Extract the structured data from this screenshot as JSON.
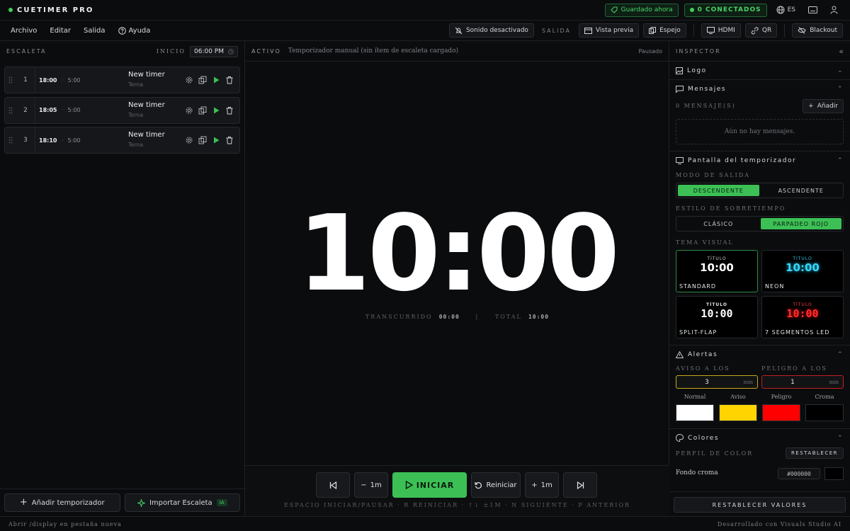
{
  "app": {
    "brand": "CUETIMER PRO"
  },
  "top": {
    "saved": "Guardado ahora",
    "connected": "0 CONECTADOS",
    "lang": "ES"
  },
  "menu": {
    "archivo": "Archivo",
    "editar": "Editar",
    "salida": "Salida",
    "ayuda": "Ayuda"
  },
  "toolbar": {
    "sound": "Sonido desactivado",
    "salida_label": "SALIDA",
    "preview": "Vista previa",
    "mirror": "Espejo",
    "hdmi": "HDMI",
    "qr": "QR",
    "blackout": "Blackout"
  },
  "left": {
    "title": "ESCALETA",
    "inicio_label": "INICIO",
    "start_time": "06:00 PM",
    "rows": [
      {
        "num": "1",
        "time": "18:00",
        "dot": "·",
        "dur": "5:00",
        "name": "New timer",
        "tema": "Tema"
      },
      {
        "num": "2",
        "time": "18:05",
        "dot": "·",
        "dur": "5:00",
        "name": "New timer",
        "tema": "Tema"
      },
      {
        "num": "3",
        "time": "18:10",
        "dot": "·",
        "dur": "5:00",
        "name": "New timer",
        "tema": "Tema"
      }
    ],
    "add": "Añadir temporizador",
    "import": "Importar Escaleta",
    "ia": "IA"
  },
  "center": {
    "active": "ACTIVO",
    "desc": "Temporizador manual (sin ítem de escaleta cargado)",
    "state": "Pausado",
    "time": "10:00",
    "elapsed_label": "TRANSCURRIDO",
    "elapsed": "00:00",
    "divider": "|",
    "total_label": "TOTAL",
    "total": "10:00",
    "minus": "1m",
    "play": "INICIAR",
    "reset": "Reiniciar",
    "plus": "1m",
    "shortcuts": "ESPACIO INICIAR/PAUSAR · R REINICIAR · ↑↓ ±1M · N SIGUIENTE · P ANTERIOR"
  },
  "inspector": {
    "title": "INSPECTOR",
    "logo": "Logo",
    "mensajes": "Mensajes",
    "msg_count": "0 MENSAJE(S)",
    "add": "Añadir",
    "empty": "Aún no hay mensajes.",
    "pantalla": "Pantalla del temporizador",
    "modo_label": "MODO DE SALIDA",
    "desc": "DESCENDENTE",
    "asc": "ASCENDENTE",
    "over_label": "ESTILO DE SOBRETIEMPO",
    "clasico": "CLÁSICO",
    "parpadeo": "PARPADEO ROJO",
    "tema_label": "TEMA VISUAL",
    "themes": [
      {
        "title": "TÍTULO",
        "value": "10:00",
        "name": "STANDARD"
      },
      {
        "title": "TÍTULO",
        "value": "10:00",
        "name": "NEON"
      },
      {
        "title": "TÍTULO",
        "value": "10:00",
        "name": "SPLIT-FLAP"
      },
      {
        "title": "TÍTULO",
        "value": "10:00",
        "name": "7 SEGMENTOS LED"
      }
    ],
    "alertas": "Alertas",
    "aviso_label": "AVISO A LOS",
    "aviso": "3",
    "peligro_label": "PELIGRO A LOS",
    "peligro": "1",
    "unit": "min",
    "swatches": [
      {
        "name": "Normal",
        "color": "#ffffff"
      },
      {
        "name": "Aviso",
        "color": "#ffd400"
      },
      {
        "name": "Peligro",
        "color": "#ff0000"
      },
      {
        "name": "Croma",
        "color": "#000000"
      }
    ],
    "colores": "Colores",
    "perfil": "PERFIL DE COLOR",
    "restablecer": "RESTABLECER",
    "fondo": "Fondo croma",
    "fondo_hex": "#000000",
    "reset_all": "RESTABLECER VALORES"
  },
  "status": {
    "left": "Abrir /display en pestaña nueva",
    "right": "Desarrollado con Visuals Studio AI"
  }
}
